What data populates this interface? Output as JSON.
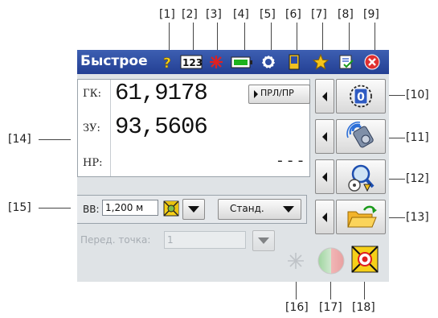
{
  "callouts": [
    "[1]",
    "[2]",
    "[3]",
    "[4]",
    "[5]",
    "[6]",
    "[7]",
    "[8]",
    "[9]",
    "[10]",
    "[11]",
    "[12]",
    "[13]",
    "[14]",
    "[15]",
    "[16]",
    "[17]",
    "[18]"
  ],
  "app": {
    "title": "Быстрое"
  },
  "toolbar": {
    "icons": [
      "help-icon",
      "input-mode-icon",
      "laser-icon",
      "battery-icon",
      "settings-icon",
      "device-icon",
      "favorites-icon",
      "checklist-icon",
      "close-icon"
    ],
    "input_mode_label": "123",
    "help_glyph": "?"
  },
  "measure": {
    "rows": [
      {
        "label": "ГК:",
        "value": "61,9178"
      },
      {
        "label": "ЗУ:",
        "value": "93,5606"
      },
      {
        "label": "НР:",
        "value": "---"
      }
    ],
    "toggle_label": "ПРЛ/ПР"
  },
  "side_buttons": [
    "zero-set-icon",
    "measure-icon",
    "target-search-icon",
    "open-folder-icon"
  ],
  "zero_label": "0",
  "vv": {
    "label": "ВВ:",
    "value": "1,200 м",
    "mode_label": "Станд."
  },
  "prev_point": {
    "label": "Перед. точка:",
    "value": "1"
  },
  "colors": {
    "titlebar": "#2b4a9e",
    "screen": "#dfe3e6",
    "battery": "#1db21d",
    "close": "#e03030"
  }
}
